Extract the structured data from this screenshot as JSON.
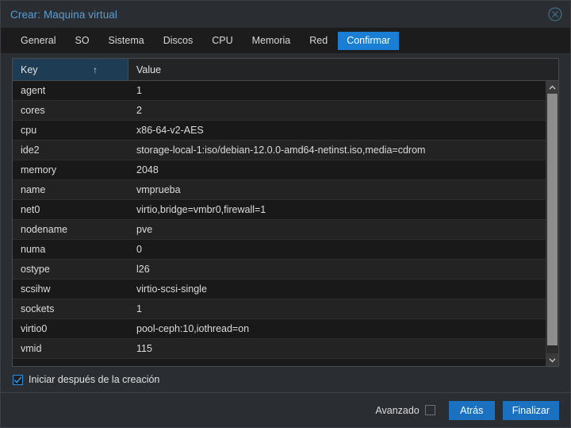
{
  "window": {
    "title": "Crear: Maquina virtual",
    "close_icon": "close-circle-icon"
  },
  "tabs": [
    {
      "label": "General",
      "active": false
    },
    {
      "label": "SO",
      "active": false
    },
    {
      "label": "Sistema",
      "active": false
    },
    {
      "label": "Discos",
      "active": false
    },
    {
      "label": "CPU",
      "active": false
    },
    {
      "label": "Memoria",
      "active": false
    },
    {
      "label": "Red",
      "active": false
    },
    {
      "label": "Confirmar",
      "active": true
    }
  ],
  "table": {
    "columns": [
      {
        "label": "Key",
        "sorted": true,
        "sort_indicator": "↑"
      },
      {
        "label": "Value",
        "sorted": false,
        "sort_indicator": ""
      }
    ],
    "rows": [
      {
        "key": "agent",
        "value": "1"
      },
      {
        "key": "cores",
        "value": "2"
      },
      {
        "key": "cpu",
        "value": "x86-64-v2-AES"
      },
      {
        "key": "ide2",
        "value": "storage-local-1:iso/debian-12.0.0-amd64-netinst.iso,media=cdrom"
      },
      {
        "key": "memory",
        "value": "2048"
      },
      {
        "key": "name",
        "value": "vmprueba"
      },
      {
        "key": "net0",
        "value": "virtio,bridge=vmbr0,firewall=1"
      },
      {
        "key": "nodename",
        "value": "pve"
      },
      {
        "key": "numa",
        "value": "0"
      },
      {
        "key": "ostype",
        "value": "l26"
      },
      {
        "key": "scsihw",
        "value": "virtio-scsi-single"
      },
      {
        "key": "sockets",
        "value": "1"
      },
      {
        "key": "virtio0",
        "value": "pool-ceph:10,iothread=on"
      },
      {
        "key": "vmid",
        "value": "115"
      }
    ]
  },
  "scrollbar": {
    "up_icon": "chevron-up-icon",
    "down_icon": "chevron-down-icon"
  },
  "start_option": {
    "label": "Iniciar después de la creación",
    "checked": true
  },
  "footer": {
    "advanced_label": "Avanzado",
    "advanced_checked": false,
    "back_label": "Atrás",
    "finish_label": "Finalizar"
  },
  "colors": {
    "accent": "#1a7fd4",
    "button": "#1a71bf",
    "title": "#5b9ed6",
    "sorted_column": "#1f3c55"
  }
}
